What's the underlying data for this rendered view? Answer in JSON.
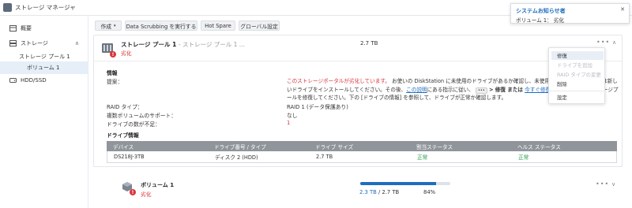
{
  "window": {
    "title": "ストレージ マネージャ"
  },
  "sidebar": {
    "items": [
      {
        "label": "概要"
      },
      {
        "label": "ストレージ"
      },
      {
        "label": "ストレージ プール 1"
      },
      {
        "label": "ボリューム 1"
      },
      {
        "label": "HDD/SSD"
      }
    ]
  },
  "toolbar": {
    "create": "作成",
    "scrub": "Data Scrubbing を実行する",
    "hotspare": "Hot Spare",
    "global": "グローバル設定"
  },
  "pool": {
    "title": "ストレージ プール 1",
    "subtitle": "- ストレージ プール 1 ...",
    "status": "劣化",
    "size": "2.7 TB",
    "info_heading": "情報",
    "suggestion_label": "提案：",
    "suggestion": {
      "red": "このストレージポータルが劣化しています。",
      "p1": "お使いの DiskStation に未使用のドライブがあるか確認し、未使用のドライブがない場合は新しいドライブをインストールしてください。その後、",
      "link1": "この説明",
      "p2": "にある指示に従い、",
      "kbd": "•••",
      "p3": "> 修復 または",
      "link2": "今すぐ修復",
      "p4": "をクリックしてストレージプールを修復してください。下の [ドライブの情報] を参照して、ドライブが正常か確認します。"
    },
    "raid_label": "RAID タイプ：",
    "raid_value": "RAID 1 (データ保護あり)",
    "multi_label": "複数ボリュームのサポート：",
    "multi_value": "なし",
    "missing_label": "ドライブの数が不足：",
    "missing_value": "1",
    "drive_heading": "ドライブ情報",
    "table": {
      "headers": [
        "デバイス",
        "ドライブ番号 / タイプ",
        "ドライブ サイズ",
        "割当ステータス",
        "ヘルス ステータス"
      ],
      "rows": [
        [
          "DS218J-3TB",
          "ディスク 2 (HDD)",
          "2.7 TB",
          "正常",
          "正常"
        ]
      ]
    }
  },
  "volume": {
    "title": "ボリューム 1",
    "status": "劣化",
    "used": "2.3 TB",
    "total": "/ 2.7 TB",
    "percent": "84%",
    "usage_fraction": 0.84
  },
  "menu": {
    "items": [
      "修復",
      "ドライブを追加",
      "RAID タイプの変更",
      "削除",
      "設定"
    ]
  },
  "notification": {
    "title": "システムお知らせ者",
    "message": "ボリューム 1： 劣化"
  },
  "colors": {
    "accent": "#1f6dbf",
    "error": "#d9343a",
    "ok": "#2a9d4b"
  }
}
